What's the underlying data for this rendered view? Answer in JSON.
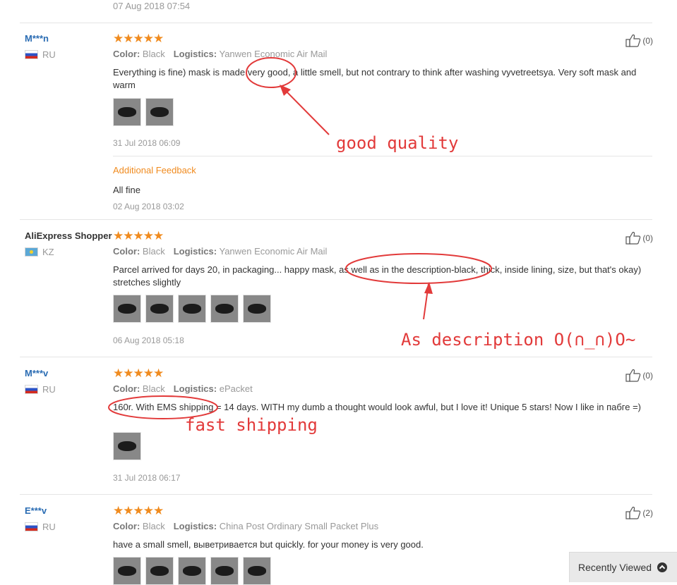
{
  "top": {
    "date": "07 Aug 2018 07:54"
  },
  "reviews": [
    {
      "user": "M***n",
      "country": "RU",
      "flag": "ru",
      "stars": "★★★★★",
      "color_label": "Color:",
      "color": "Black",
      "logistics_label": "Logistics:",
      "logistics": "Yanwen Economic Air Mail",
      "text": "Everything is fine) mask is made very good, a little smell, but not contrary to think after washing vyvetreetsya. Very soft mask and warm",
      "date": "31 Jul 2018 06:09",
      "helpful": "(0)",
      "additional": {
        "title": "Additional Feedback",
        "text": "All fine",
        "date": "02 Aug 2018 03:02"
      }
    },
    {
      "user": "AliExpress Shopper",
      "country": "KZ",
      "flag": "kz",
      "stars": "★★★★★",
      "color_label": "Color:",
      "color": "Black",
      "logistics_label": "Logistics:",
      "logistics": "Yanwen Economic Air Mail",
      "text": "Parcel arrived for days 20, in packaging... happy mask, as well as in the description-black, thick, inside lining, size, but that's okay) stretches slightly",
      "date": "06 Aug 2018 05:18",
      "helpful": "(0)"
    },
    {
      "user": "M***v",
      "country": "RU",
      "flag": "ru",
      "stars": "★★★★★",
      "color_label": "Color:",
      "color": "Black",
      "logistics_label": "Logistics:",
      "logistics": "ePacket",
      "text": "160r. With EMS shipping = 14 days. WITH my dumb a thought would look awful, but I love it! Unique 5 stars! Now I like in пабге =)",
      "date": "31 Jul 2018 06:17",
      "helpful": "(0)"
    },
    {
      "user": "E***v",
      "country": "RU",
      "flag": "ru",
      "stars": "★★★★★",
      "color_label": "Color:",
      "color": "Black",
      "logistics_label": "Logistics:",
      "logistics": "China Post Ordinary Small Packet Plus",
      "text": "have a small smell, выветривается but quickly. for your money is very good.",
      "helpful": "(2)"
    }
  ],
  "annotations": {
    "good_quality": "good quality",
    "as_description": "As description O(∩_∩)O~",
    "fast_shipping": "fast shipping",
    "color": "#e23a3a"
  },
  "recently_viewed": {
    "label": "Recently Viewed",
    "icon": "chevron-up-circle-icon"
  },
  "colors": {
    "username": "#2a6cb3",
    "stars": "#f08b1f",
    "additional_title": "#f08b1f"
  }
}
